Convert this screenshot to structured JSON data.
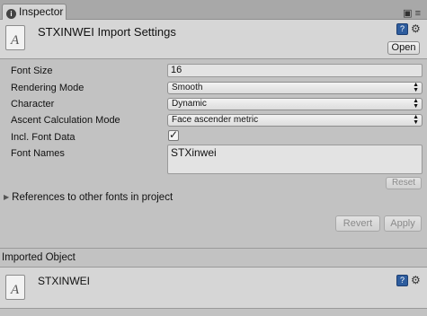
{
  "tab": {
    "icon": "info-icon",
    "label": "Inspector"
  },
  "header": {
    "icon": "font-file-icon",
    "icon_glyph": "A",
    "title": "STXINWEI Import Settings",
    "open_label": "Open"
  },
  "settings": {
    "font_size": {
      "label": "Font Size",
      "value": "16"
    },
    "rendering_mode": {
      "label": "Rendering Mode",
      "value": "Smooth"
    },
    "character": {
      "label": "Character",
      "value": "Dynamic"
    },
    "ascent": {
      "label": "Ascent Calculation Mode",
      "value": "Face ascender metric"
    },
    "incl_font_data": {
      "label": "Incl. Font Data",
      "checked": true
    },
    "font_names": {
      "label": "Font Names",
      "value": "STXinwei"
    },
    "reset_label": "Reset"
  },
  "references_label": "References to other fonts in project",
  "buttons": {
    "revert": "Revert",
    "apply": "Apply"
  },
  "imported": {
    "section_label": "Imported Object",
    "icon_glyph": "A",
    "title": "STXINWEI"
  }
}
